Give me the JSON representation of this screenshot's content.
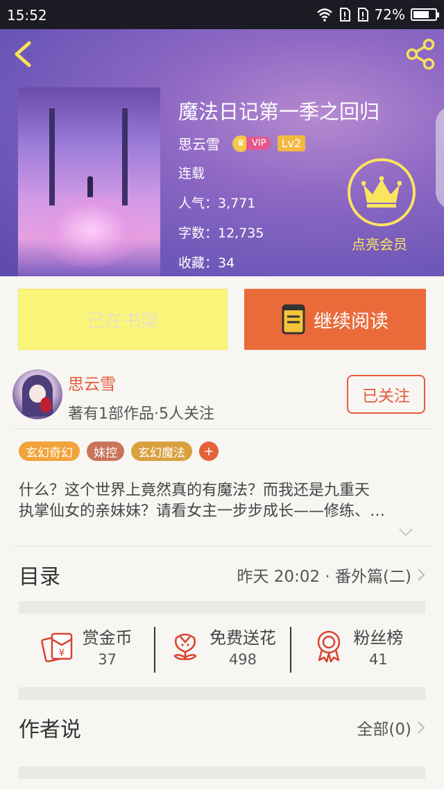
{
  "status_bar": {
    "time": "15:52",
    "battery": "72%",
    "battery_level": 0.72
  },
  "book": {
    "title": "魔法日记第一季之回归",
    "author": "思云雪",
    "vip_label": "VIP",
    "level": "Lv2",
    "status": "连载",
    "popularity": "人气：3,771",
    "word_count": "字数：12,735",
    "favorites": "收藏：34"
  },
  "member": {
    "label": "点亮会员"
  },
  "actions": {
    "shelf_label": "已在书架",
    "read_label": "继续阅读"
  },
  "author_card": {
    "name": "思云雪",
    "stats": "著有1部作品·5人关注",
    "follow_label": "已关注"
  },
  "tags": [
    {
      "label": "玄幻奇幻",
      "color": "#f2a33a"
    },
    {
      "label": "妹控",
      "color": "#c9745a"
    },
    {
      "label": "玄幻魔法",
      "color": "#d9a040"
    }
  ],
  "tag_add": "+",
  "description": {
    "line1": "什么？这个世界上竟然真的有魔法？而我还是九重天",
    "line2": "执掌仙女的亲妹妹？请看女主一步步成长——修练、…"
  },
  "catalog": {
    "title": "目录",
    "latest": "昨天 20:02 · 番外篇(二)"
  },
  "stats": [
    {
      "name": "赏金币",
      "value": "37",
      "icon": "red-envelope-icon"
    },
    {
      "name": "免费送花",
      "value": "498",
      "icon": "flower-icon"
    },
    {
      "name": "粉丝榜",
      "value": "41",
      "icon": "medal-icon"
    }
  ],
  "author_says": {
    "title": "作者说",
    "count": "全部(0)"
  },
  "colors": {
    "accent": "#ea6a3a",
    "shelf": "#fbf57a",
    "member": "#fbe55f",
    "stat_icon": "#d8432f"
  }
}
